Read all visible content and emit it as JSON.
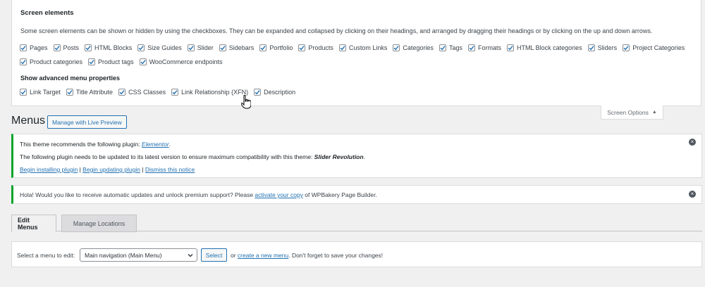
{
  "screen_options": {
    "title": "Screen elements",
    "description": "Some screen elements can be shown or hidden by using the checkboxes. They can be expanded and collapsed by clicking on their headings, and arranged by dragging their headings or by clicking on the up and down arrows.",
    "elements_row1": [
      "Pages",
      "Posts",
      "HTML Blocks",
      "Size Guides",
      "Slider",
      "Sidebars",
      "Portfolio",
      "Products",
      "Custom Links",
      "Categories",
      "Tags",
      "Formats",
      "HTML Block categories",
      "Sliders",
      "Project Categories"
    ],
    "elements_row2": [
      "Product categories",
      "Product tags",
      "WooCommerce endpoints"
    ],
    "advanced_title": "Show advanced menu properties",
    "advanced": [
      "Link Target",
      "Title Attribute",
      "CSS Classes",
      "Link Relationship (XFN)",
      "Description"
    ],
    "tab_label": "Screen Options"
  },
  "page": {
    "title": "Menus",
    "live_preview_button": "Manage with Live Preview"
  },
  "notice1": {
    "line1_prefix": "This theme recommends the following plugin: ",
    "line1_plugin": "Elementor",
    "line1_suffix": ".",
    "line2_prefix": "The following plugin needs to be updated to its latest version to ensure maximum compatibility with this theme: ",
    "line2_plugin": "Slider Revolution",
    "line2_suffix": ".",
    "link_install": "Begin installing plugin",
    "link_update": "Begin updating plugin",
    "link_dismiss": "Dismiss this notice",
    "separator": " | "
  },
  "notice2": {
    "prefix": "Hola! Would you like to receive automatic updates and unlock premium support? Please ",
    "link": "activate your copy",
    "suffix": " of WPBakery Page Builder."
  },
  "tabs": {
    "edit": "Edit Menus",
    "locations": "Manage Locations"
  },
  "menu_select": {
    "label": "Select a menu to edit:",
    "selected": "Main navigation (Main Menu)",
    "button": "Select",
    "or_text": "or ",
    "create_link": "create a new menu",
    "tail": ". Don't forget to save your changes!"
  },
  "colors": {
    "accent": "#2271b1",
    "success": "#00a32a",
    "background": "#f0f0f1"
  }
}
